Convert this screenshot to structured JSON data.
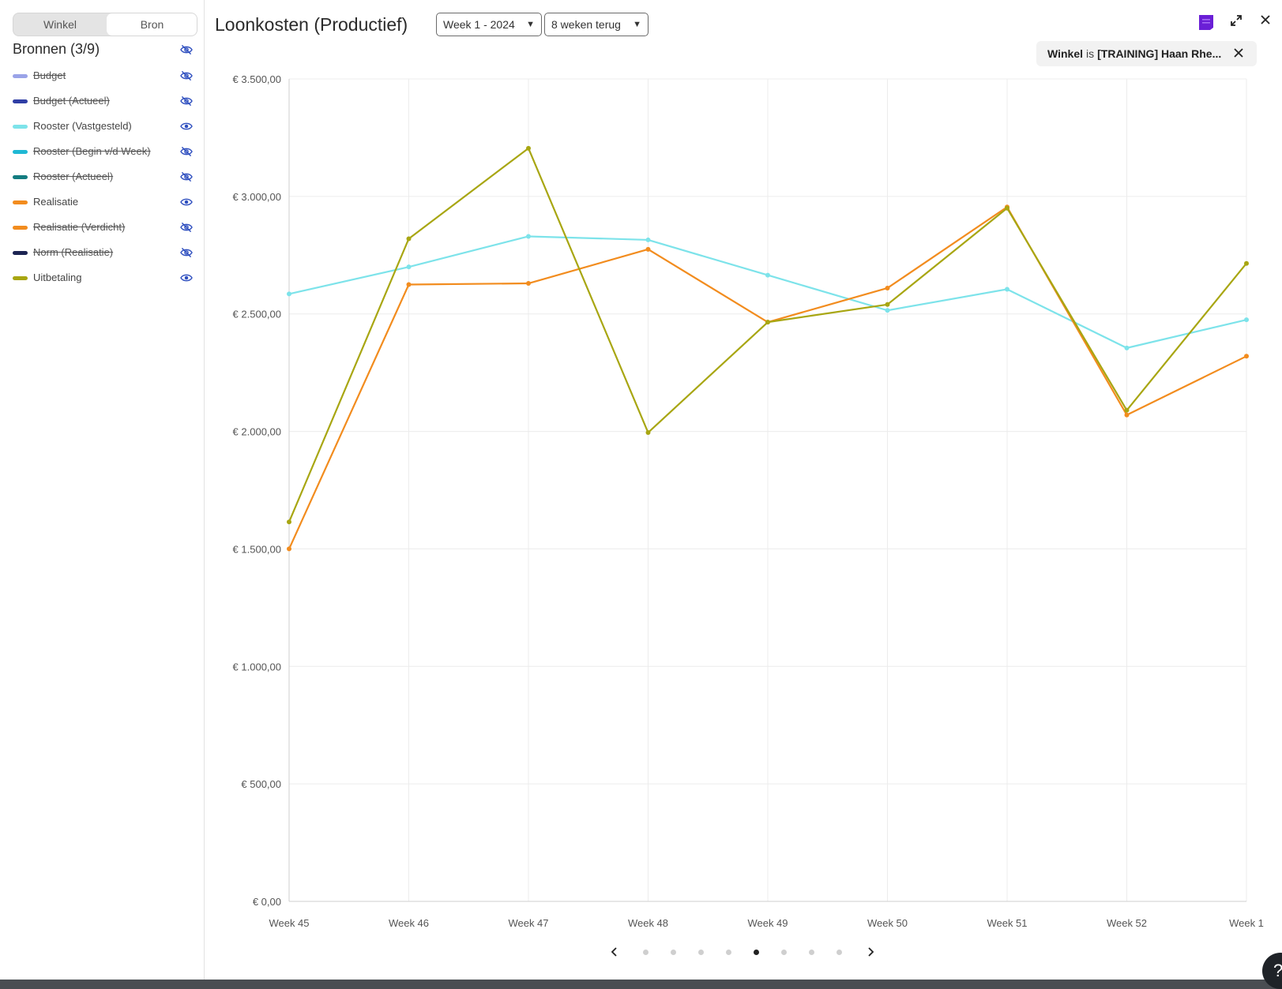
{
  "sidebar": {
    "toggle": {
      "winkel": "Winkel",
      "bron": "Bron",
      "active": "Bron"
    },
    "sources_title": "Bronnen (3/9)",
    "sources": [
      {
        "label": "Budget",
        "color": "#9aa3e8",
        "visible": false
      },
      {
        "label": "Budget (Actueel)",
        "color": "#2f3ea5",
        "visible": false
      },
      {
        "label": "Rooster (Vastgesteld)",
        "color": "#7de3ea",
        "visible": true
      },
      {
        "label": "Rooster (Begin v/d Week)",
        "color": "#1fb8d4",
        "visible": false
      },
      {
        "label": "Rooster (Actueel)",
        "color": "#137c80",
        "visible": false
      },
      {
        "label": "Realisatie",
        "color": "#f28c1e",
        "visible": true
      },
      {
        "label": "Realisatie (Verdicht)",
        "color": "#f28c1e",
        "visible": false
      },
      {
        "label": "Norm (Realisatie)",
        "color": "#1c2452",
        "visible": false
      },
      {
        "label": "Uitbetaling",
        "color": "#a8a612",
        "visible": true
      }
    ]
  },
  "header": {
    "title": "Loonkosten (Productief)",
    "week_select": "Week 1 - 2024",
    "range_select": "8 weken terug",
    "filter": {
      "field": "Winkel",
      "operator": "is",
      "value": "[TRAINING] Haan Rhe..."
    },
    "icons": {
      "widget": "widget-icon",
      "expand": "expand-icon",
      "close": "close-icon"
    },
    "accent": "#6a1fd6"
  },
  "chart_data": {
    "type": "line",
    "categories": [
      "Week 45",
      "Week 46",
      "Week 47",
      "Week 48",
      "Week 49",
      "Week 50",
      "Week 51",
      "Week 52",
      "Week 1"
    ],
    "y_ticks": [
      "€ 0,00",
      "€ 500,00",
      "€ 1.000,00",
      "€ 1.500,00",
      "€ 2.000,00",
      "€ 2.500,00",
      "€ 3.000,00",
      "€ 3.500,00"
    ],
    "ylim": [
      0,
      3500
    ],
    "grid": true,
    "series": [
      {
        "name": "Rooster (Vastgesteld)",
        "color": "#7de3ea",
        "values": [
          2585,
          2700,
          2830,
          2815,
          2665,
          2515,
          2605,
          2355,
          2475
        ]
      },
      {
        "name": "Realisatie",
        "color": "#f28c1e",
        "values": [
          1500,
          2625,
          2630,
          2775,
          2465,
          2610,
          2955,
          2070,
          2320
        ]
      },
      {
        "name": "Uitbetaling",
        "color": "#a8a612",
        "values": [
          1615,
          2820,
          3205,
          1995,
          2465,
          2540,
          2950,
          2090,
          2715
        ]
      }
    ]
  },
  "pager": {
    "pages": 8,
    "active_index": 4
  },
  "help": "?"
}
